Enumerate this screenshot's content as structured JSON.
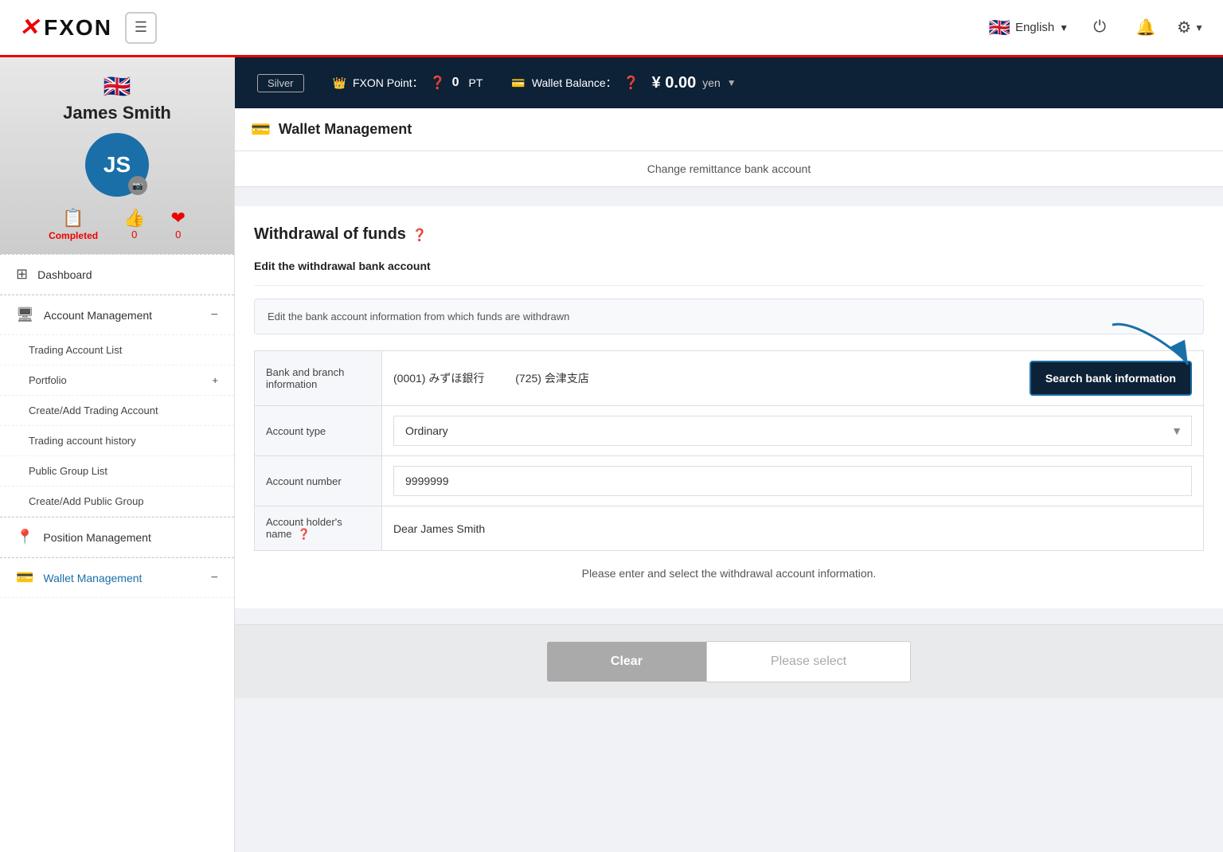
{
  "topnav": {
    "logo": "FXON",
    "hamburger_label": "☰",
    "language": "English",
    "language_flag": "🇬🇧",
    "power_icon": "⏻",
    "bell_icon": "🔔",
    "gear_icon": "⚙"
  },
  "header_bar": {
    "silver_label": "Silver",
    "fxon_point_label": "FXON Point：",
    "fxon_point_value": "0",
    "pt_label": "PT",
    "wallet_balance_label": "Wallet Balance：",
    "balance_symbol": "¥",
    "balance_value": "0.00",
    "balance_currency": "yen"
  },
  "sidebar": {
    "profile_flag": "🇬🇧",
    "profile_name": "James Smith",
    "avatar_initials": "JS",
    "camera_icon": "📷",
    "stats": [
      {
        "icon": "📋",
        "label": "Completed",
        "value": ""
      },
      {
        "icon": "👍",
        "label": "",
        "value": "0"
      },
      {
        "icon": "❤",
        "label": "",
        "value": "0"
      }
    ],
    "menu_items": [
      {
        "id": "dashboard",
        "icon": "⊞",
        "label": "Dashboard",
        "expand": ""
      },
      {
        "id": "account-management",
        "icon": "🖥",
        "label": "Account Management",
        "expand": "−"
      },
      {
        "id": "trading-account-list",
        "label": "Trading Account List",
        "sub": true
      },
      {
        "id": "portfolio",
        "label": "Portfolio",
        "sub": true,
        "expand": "+"
      },
      {
        "id": "create-trading-account",
        "label": "Create/Add Trading Account",
        "sub": true
      },
      {
        "id": "trading-account-history",
        "label": "Trading account history",
        "sub": true
      },
      {
        "id": "public-group-list",
        "label": "Public Group List",
        "sub": true
      },
      {
        "id": "create-public-group",
        "label": "Create/Add Public Group",
        "sub": true
      },
      {
        "id": "position-management",
        "icon": "📍",
        "label": "Position Management",
        "expand": ""
      },
      {
        "id": "wallet-management",
        "icon": "💳",
        "label": "Wallet Management",
        "expand": "−",
        "active": true
      }
    ]
  },
  "page": {
    "section_icon": "💳",
    "section_title": "Wallet Management",
    "breadcrumb": "Change remittance bank account",
    "withdrawal_title": "Withdrawal of funds",
    "edit_label": "Edit the withdrawal bank account",
    "info_box_text": "Edit the bank account information from which funds are withdrawn",
    "bank_table": {
      "rows": [
        {
          "label": "Bank and branch information",
          "bank_code": "(0001) みずほ銀行",
          "branch_code": "(725) 会津支店",
          "search_btn": "Search bank information"
        },
        {
          "label": "Account type",
          "value": "Ordinary",
          "type": "select"
        },
        {
          "label": "Account number",
          "value": "9999999",
          "type": "input"
        },
        {
          "label": "Account holder's name",
          "value": "Dear James Smith",
          "type": "text",
          "has_help": true
        }
      ]
    },
    "notice_text": "Please enter and select the withdrawal account information.",
    "action_bar": {
      "clear_label": "Clear",
      "select_label": "Please select"
    }
  }
}
